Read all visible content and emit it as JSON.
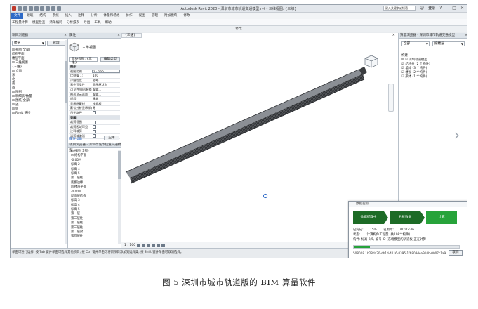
{
  "window": {
    "title": "Autodesk Revit 2020 - 深圳市城市轨道交通模型.rvt - 三维视图: {三维}",
    "search_placeholder": "键入关键字或短语",
    "user": "登录"
  },
  "ribbon": {
    "tabs": [
      "文件",
      "建筑",
      "结构",
      "系统",
      "插入",
      "注释",
      "分析",
      "体量和场地",
      "协作",
      "视图",
      "管理",
      "附加模块",
      "修改"
    ],
    "panel_items": [
      "工程量计算",
      "模型检查",
      "清单编码",
      "分析报表",
      "导出",
      "工具",
      "帮助"
    ],
    "mode_label": "修改"
  },
  "browser_panel": {
    "title": "项目浏览器",
    "dropdown": "楼层",
    "button": "管理",
    "tree": [
      "⊟ 视图(全部)",
      "   结构平面",
      "   楼层平面",
      "⊟ 三维视图",
      "   {三维}",
      "⊟ 立面",
      "   东",
      "   北",
      "   南",
      "   西",
      "⊞ 图例",
      "⊞ 明细表/数量",
      "⊞ 图纸(全部)",
      "⊞ 族",
      "⊞ 组",
      "⊞ Revit 链接"
    ]
  },
  "properties_panel": {
    "title": "属性",
    "type_name": "三维视图",
    "type_selector": "三维视图: {三维}",
    "edit_type": "编辑类型",
    "rows": [
      {
        "k": "图形",
        "v": "",
        "group": true
      },
      {
        "k": "视图比例",
        "v": "1 : 100",
        "boxed": true
      },
      {
        "k": "比例值 1:",
        "v": "100"
      },
      {
        "k": "详细程度",
        "v": "粗略"
      },
      {
        "k": "零件可见性",
        "v": "显示原状态"
      },
      {
        "k": "可见性/图形替换",
        "v": "编辑..."
      },
      {
        "k": "图形显示选项",
        "v": "编辑..."
      },
      {
        "k": "规程",
        "v": "建筑"
      },
      {
        "k": "显示隐藏线",
        "v": "按规程"
      },
      {
        "k": "默认分析显示样式",
        "v": "无"
      },
      {
        "k": "日光路径",
        "v": "",
        "check": true
      },
      {
        "k": "范围",
        "v": "",
        "group": true
      },
      {
        "k": "裁剪视图",
        "v": "",
        "check": true
      },
      {
        "k": "裁剪区域可见",
        "v": "",
        "check": true
      },
      {
        "k": "注释裁剪",
        "v": "",
        "check": true
      },
      {
        "k": "远剪裁激活",
        "v": "",
        "check": true
      }
    ],
    "help_link": "属性帮助",
    "apply_button": "应用"
  },
  "project_browser": {
    "title": "项目浏览器 - 深圳市城市轨道交通模型",
    "tree": [
      "⊟ 视图(全部)",
      "  ⊟ 结构平面",
      "      -0.00M",
      "      标高 2",
      "      标高 4",
      "      标高 5",
      "      第二层柱",
      "      底板边缘",
      "  ⊟ 楼层平面",
      "      -0.00M",
      "      屋面层结构",
      "      标高 3",
      "      标高 4",
      "      标高 5",
      "      第一层",
      "      第三层柱",
      "      第二层柱",
      "      第三层柱",
      "      第二层梁",
      "      第四层柱"
    ]
  },
  "viewport": {
    "tab": "{三维}",
    "scale": "1 : 100"
  },
  "right_panel": {
    "title": "算量浏览器 - 深圳市城市轨道交通模型",
    "dropdown1": "全部",
    "dropdown2": "按楼层",
    "rows": [
      "构建",
      "⊟ ☑ 深圳轨道模型",
      "   ☑ 结构柱 (2 个构件)",
      "   ☑ 墙体 (3 个构件)",
      "   ☑ 楼板 (2 个构件)",
      "   ☑ 梁体 (1 个构件)"
    ]
  },
  "statusbar": {
    "text": "单击可进行选择; 按 Tab 键并单击可选择其他项目; 按 Ctrl 键并单击可将新项目添加到选择集; 按 Shift 键并单击可取消选择。"
  },
  "dialog": {
    "title": "数据提取",
    "steps": [
      "数据提取中",
      "分析数据",
      "计算"
    ],
    "info_line1": [
      "已完成:",
      "15%",
      "已用时:",
      "00:02:46"
    ],
    "info_line2_label": "状态:",
    "info_line2": "计算构件工程量 (共108个构件)",
    "info_line3": "构件: 标高 2/5, 编号 ID (东端模型的轨道板)正在计算",
    "progress": 0.15,
    "footer": "508028.1b28da20-db1d-4116-8395-1f6808dea910b-0007c1a9",
    "cancel_button": "取消"
  },
  "caption": "图 5  深圳市城市轨道版的 BIM 算量软件",
  "colors": {
    "accent": "#2e6ac7",
    "step_green": "#27a33a",
    "model_dark": "#3a3c3f"
  }
}
